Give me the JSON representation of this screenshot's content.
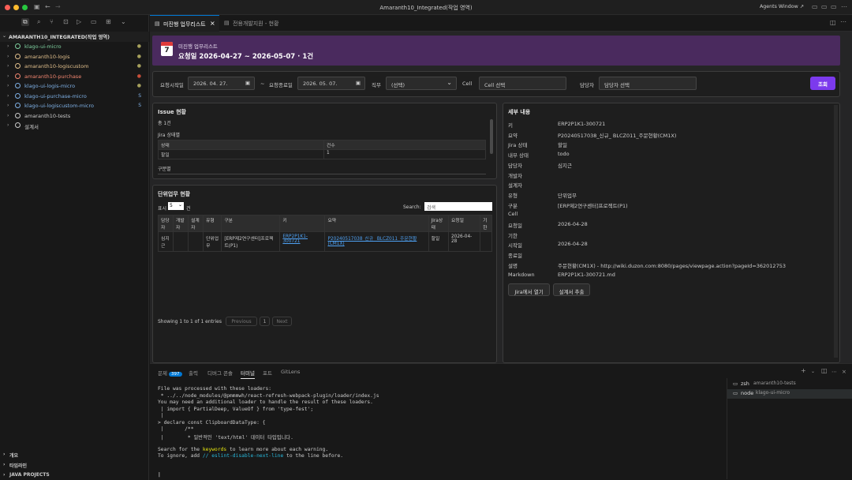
{
  "titlebar": {
    "title": "Amaranth10_Integrated(작업 영역)",
    "agents_window": "Agents Window ↗"
  },
  "sidebar": {
    "workspace": "AMARANTH10_INTEGRATED(작업 영역)",
    "items": [
      {
        "label": "klago-ui-micro",
        "status": "●",
        "color": "#7fd1a0",
        "status_color": "#a6a05c"
      },
      {
        "label": "amaranth10-logis",
        "status": "●",
        "color": "#e2c08d",
        "status_color": "#a6a05c"
      },
      {
        "label": "amaranth10-logiscustom",
        "status": "●",
        "color": "#e2c08d",
        "status_color": "#a6a05c"
      },
      {
        "label": "amaranth10-purchase",
        "status": "●",
        "color": "#f48771",
        "status_color": "#c74e39"
      },
      {
        "label": "klago-ui-logis-micro",
        "status": "●",
        "color": "#7fb1e6",
        "status_color": "#a6a05c"
      },
      {
        "label": "klago-ui-purchase-micro",
        "status": "S",
        "color": "#7fb1e6",
        "status_color": "#7fb1e6"
      },
      {
        "label": "klago-ui-logiscustom-micro",
        "status": "S",
        "color": "#7fb1e6",
        "status_color": "#7fb1e6"
      },
      {
        "label": "amaranth10-tests",
        "status": "",
        "color": "#cccccc",
        "status_color": "#cccccc"
      },
      {
        "label": "설계서",
        "status": "",
        "color": "#cccccc",
        "status_color": "#cccccc"
      }
    ],
    "footer": [
      "개요",
      "타임라인",
      "JAVA PROJECTS"
    ]
  },
  "tabs": [
    {
      "label": "미진행 업무리스트",
      "active": true
    },
    {
      "label": "전용개발지원 - 현황",
      "active": false
    }
  ],
  "hero": {
    "icon_day": "7",
    "subtitle": "미진행 업무리스트",
    "title": "요청일 2026-04-27 ~ 2026-05-07 · 1건"
  },
  "filters": {
    "start_label": "요청시작일",
    "start_value": "2026. 04. 27.",
    "tilde": "~",
    "end_label": "요청종료일",
    "end_value": "2026. 05. 07.",
    "duty_label": "직무",
    "duty_value": "(선택)",
    "cell_label": "Cell",
    "cell_placeholder": "Cell 선택",
    "owner_label": "담당자",
    "owner_placeholder": "담당자 선택",
    "search_button": "조회"
  },
  "issue_panel": {
    "title": "Issue 현황",
    "total": "총 1건",
    "jira_status_title": "Jira 상태별",
    "col_status": "상태",
    "col_count": "건수",
    "row_status": "할일",
    "row_count": "1",
    "group_title": "구분별"
  },
  "unit_panel": {
    "title": "단위업무 현황",
    "show_label": "표시",
    "show_value": "5",
    "show_suffix": "건",
    "search_label": "Search:",
    "search_value": "검색",
    "headers": [
      "담당자",
      "개발자",
      "설계자",
      "유형",
      "구분",
      "키",
      "요약",
      "Jira상태",
      "요청일",
      "기한"
    ],
    "row": [
      "심지근",
      "",
      "",
      "단위업무",
      "[ERP제2연구센터]프로젝트(P1)",
      "ERP2P1K1-300721",
      "P20240517038_신규_ BLCZ011_주문현황(CM1X)",
      "할일",
      "2026-04-28",
      ""
    ],
    "footer_info": "Showing 1 to 1 of 1 entries",
    "prev": "Previous",
    "page": "1",
    "next": "Next"
  },
  "detail_panel": {
    "title": "세부 내용",
    "rows": [
      {
        "k": "키",
        "v": "ERP2P1K1-300721"
      },
      {
        "k": "요약",
        "v": "P20240517038_신규_ BLCZ011_주문현황(CM1X)"
      },
      {
        "k": "Jira 상태",
        "v": "할일"
      },
      {
        "k": "내부 상태",
        "v": "todo"
      },
      {
        "k": "담당자",
        "v": "심지근"
      },
      {
        "k": "개발자",
        "v": ""
      },
      {
        "k": "설계자",
        "v": ""
      },
      {
        "k": "유형",
        "v": "단위업무"
      },
      {
        "k": "구분",
        "v": "[ERP제2연구센터]프로젝트(P1)"
      },
      {
        "k": "Cell",
        "v": ""
      },
      {
        "k": "요청일",
        "v": "2026-04-28"
      },
      {
        "k": "기한",
        "v": ""
      },
      {
        "k": "시작일",
        "v": "2026-04-28"
      },
      {
        "k": "종료일",
        "v": ""
      },
      {
        "k": "설명",
        "v": "주문현황(CM1X) - http://wiki.duzon.com:8080/pages/viewpage.action?pageId=362012753"
      },
      {
        "k": "Markdown",
        "v": "ERP2P1K1-300721.md"
      }
    ],
    "open_jira": "Jira에서 열기",
    "extract": "설계서 추출"
  },
  "bottom": {
    "tabs": [
      "문제",
      "출력",
      "디버그 콘솔",
      "터미널",
      "포트",
      "GitLens"
    ],
    "problems_count": "397",
    "terminals": [
      {
        "shell": "zsh",
        "name": "amaranth10-tests"
      },
      {
        "shell": "node",
        "name": "klago-ui-micro"
      }
    ],
    "lines": [
      "File was processed with these loaders:",
      " * ../../node_modules/@pmmmwh/react-refresh-webpack-plugin/loader/index.js",
      "You may need an additional loader to handle the result of these loaders.",
      " | import { PartialDeep, ValueOf } from 'type-fest';",
      " |",
      "> declare const ClipboardDataType: {",
      " |       /**",
      " |        * 일반적인 'text/html' 데이터 타입입니다.",
      "",
      "Search for the keywords to learn more about each warning.",
      "To ignore, add // eslint-disable-next-line to the line before."
    ],
    "cursor": "|"
  }
}
